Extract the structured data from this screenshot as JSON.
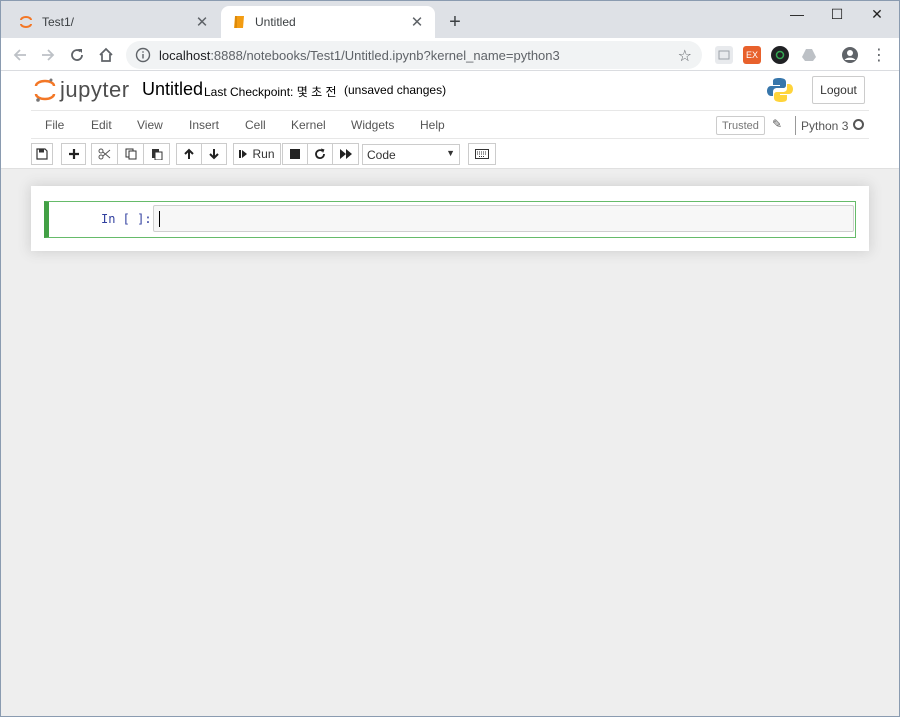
{
  "browser": {
    "tabs": [
      {
        "title": "Test1/",
        "active": false,
        "favicon": "jupyter-icon"
      },
      {
        "title": "Untitled",
        "active": true,
        "favicon": "notebook-icon"
      }
    ],
    "new_tab_label": "+",
    "address": {
      "host": "localhost",
      "path": ":8888/notebooks/Test1/Untitled.ipynb?kernel_name=python3"
    },
    "window_controls": {
      "minimize": "—",
      "maximize": "☐",
      "close": "✕"
    }
  },
  "jupyter": {
    "logo_text": "jupyter",
    "notebook_name": "Untitled",
    "checkpoint": "Last Checkpoint: 몇 초 전",
    "autosave_status": "(unsaved changes)",
    "logout_label": "Logout",
    "menu": [
      "File",
      "Edit",
      "View",
      "Insert",
      "Cell",
      "Kernel",
      "Widgets",
      "Help"
    ],
    "trusted_label": "Trusted",
    "kernel_name": "Python 3",
    "toolbar": {
      "run_label": "Run",
      "cell_type": "Code"
    },
    "cell": {
      "prompt": "In [ ]:",
      "source": ""
    }
  },
  "colors": {
    "jupyter_orange": "#f37726",
    "active_cell_border": "#42a045",
    "prompt_blue": "#303f9f"
  }
}
